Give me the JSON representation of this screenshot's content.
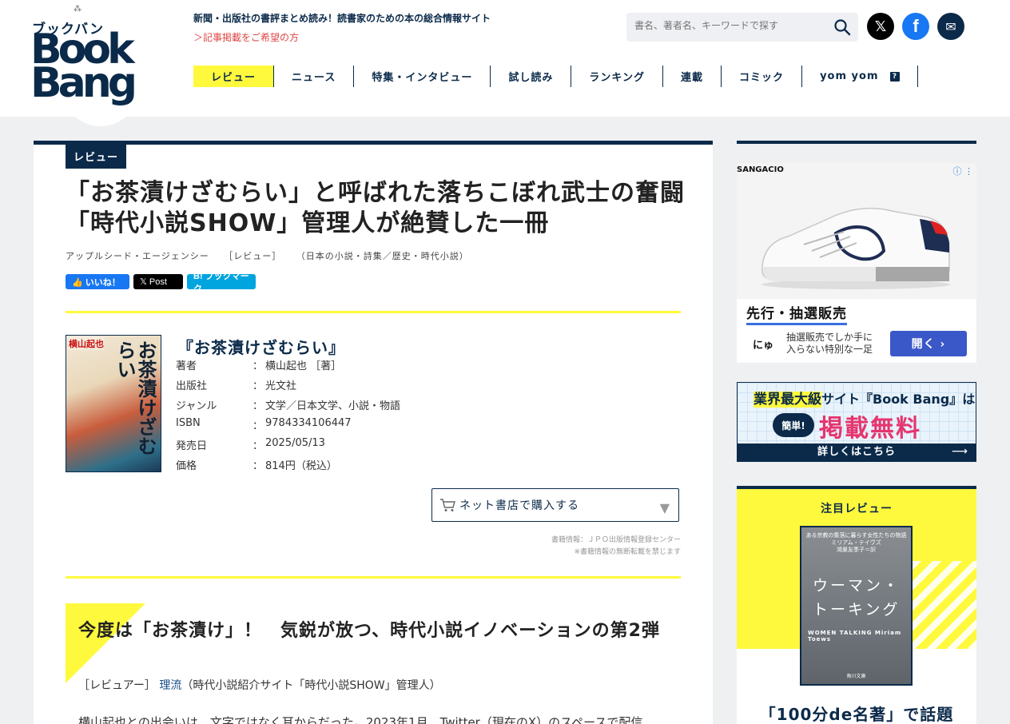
{
  "header": {
    "logo": {
      "kana": "ブックバン",
      "line1": "Book",
      "line2": "Bang"
    },
    "tagline": "新聞・出版社の書評まとめ読み！読書家のための本の総合情報サイト",
    "recruit_link": "＞記事掲載をご希望の方",
    "search_placeholder": "書名、著者名、キーワードで探す",
    "search_icon": "search-icon",
    "social": {
      "x_icon": "x-logo-icon",
      "facebook_icon": "facebook-icon",
      "mail_icon": "mail-icon"
    },
    "nav": [
      "レビュー",
      "ニュース",
      "特集・インタビュー",
      "試し読み",
      "ランキング",
      "連載",
      "コミック",
      "yom yom"
    ],
    "nav_help_badge": "?"
  },
  "article": {
    "category_badge": "レビュー",
    "title": "「お茶漬けざむらい」と呼ばれた落ちこぼれ武士の奮闘　「時代小説SHOW」管理人が絶賛した一冊",
    "meta": {
      "publisher": "アップルシード・エージェンシー",
      "type": "［レビュー］",
      "genre": "（日本の小説・詩集／歴史・時代小説）"
    },
    "share": {
      "like": "👍 いいね！",
      "post": "𝕏 Post",
      "hatena": "B! ブックマーク"
    },
    "book": {
      "cover_author": "横山起也",
      "cover_title": "お茶漬けざむらい",
      "title": "『お茶漬けざむらい』",
      "info": [
        {
          "label": "著者",
          "value": "横山起也 ［著］"
        },
        {
          "label": "出版社",
          "value": "光文社"
        },
        {
          "label": "ジャンル",
          "value": "文学／日本文学、小説・物語"
        },
        {
          "label": "ISBN",
          "value": "9784334106447"
        },
        {
          "label": "発売日",
          "value": "2025/05/13"
        },
        {
          "label": "価格",
          "value": "814円（税込）"
        }
      ],
      "colon": "：",
      "buy_button": "ネット書店で購入する",
      "credit_line1": "書籍情報：ＪＰＯ出版情報登録センター",
      "credit_line2": "※書籍情報の無断転載を禁じます"
    },
    "section_title": "今度は「お茶漬け」！　気鋭が放つ、時代小説イノベーションの第2弾",
    "reviewer": {
      "prefix": "［レビュアー］",
      "name": "理流",
      "suffix": "（時代小説紹介サイト「時代小説SHOW」管理人）"
    },
    "body": "横山起也との出会いは、文字ではなく耳からだった。2023年1月、Twitter（現在のX）のスペースで配信"
  },
  "sidebar": {
    "ad1": {
      "brand": "SANGACIO",
      "info_icon": "ⓘ ⋮",
      "headline": "先行・抽選販売",
      "logo": "にゅ",
      "desc_line1": "抽選販売でしか手に",
      "desc_line2": "入らない特別な一足",
      "button": "開く ›"
    },
    "ad2": {
      "line1_a": "業界最大級",
      "line1_b": "サイト『Book Bang』は",
      "badge": "簡単!",
      "big": "掲載無料",
      "cta": "詳しくはこちら",
      "arrow": "⟶"
    },
    "featured": {
      "label": "注目レビュー",
      "cover_small": "ある宗教の集落に暮らす女性たちの物語\nミリアム・テイヴズ\n鴻巣友季子＝訳",
      "cover_title_1": "ウーマン・",
      "cover_title_2": "トーキング",
      "cover_en": "WOMEN TALKING Miriam Toews",
      "cover_pub": "角川文庫",
      "caption": "「100分de名著」で話題"
    }
  },
  "colors": {
    "navy": "#0b2a4a",
    "highlight_yellow": "#fff93d",
    "link_red": "#e04545",
    "ad_button": "#3a58c8",
    "ad_pink": "#e5356f"
  }
}
